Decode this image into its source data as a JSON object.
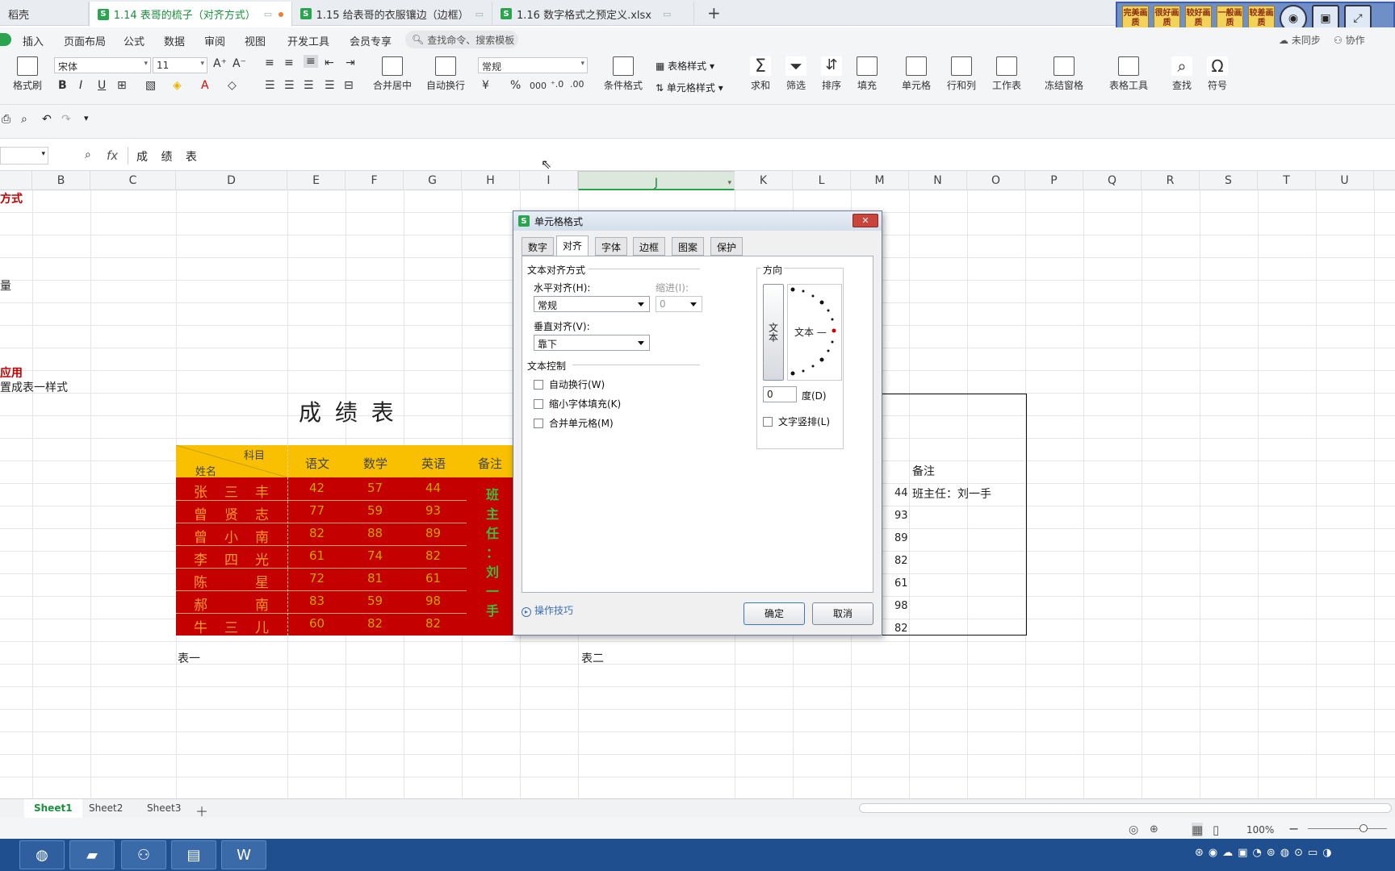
{
  "tabs": [
    {
      "label": "稻壳"
    },
    {
      "label": "1.14 表哥的梳子（对齐方式）"
    },
    {
      "label": "1.15 给表哥的衣服镶边（边框）"
    },
    {
      "label": "1.16 数字格式之预定义.xlsx"
    }
  ],
  "new_tab": "+",
  "quality_buttons": [
    "完美画质",
    "很好画质",
    "较好画质",
    "一般画质",
    "较差画质"
  ],
  "sync": {
    "not_synced": "未同步",
    "collab": "协作"
  },
  "menu": [
    "插入",
    "页面布局",
    "公式",
    "数据",
    "审阅",
    "视图",
    "开发工具",
    "会员专享"
  ],
  "search_cmd": "查找命令、搜索模板",
  "ribbon": {
    "format_brush": "格式刷",
    "font_name": "宋体",
    "font_size": "11",
    "merge_center": "合并居中",
    "auto_wrap": "自动换行",
    "num_format": "常规",
    "cond_format": "条件格式",
    "table_style": "表格样式",
    "cell_style": "单元格样式",
    "sum": "求和",
    "filter": "筛选",
    "sort": "排序",
    "fill": "填充",
    "cell": "单元格",
    "row_col": "行和列",
    "worksheet": "工作表",
    "freeze": "冻结窗格",
    "table_tools": "表格工具",
    "find": "查找",
    "symbol": "符号",
    "yen": "¥",
    "percent": "%",
    "thousands": "000"
  },
  "formula": {
    "fx": "fx",
    "value": "成 绩 表"
  },
  "columns": [
    "B",
    "C",
    "D",
    "E",
    "F",
    "G",
    "H",
    "I",
    "J",
    "K",
    "L",
    "M",
    "N",
    "O",
    "P",
    "Q",
    "R",
    "S",
    "T",
    "U"
  ],
  "left_text": {
    "a": "方式",
    "b": "量",
    "c": "应用",
    "d": "置成表一样式"
  },
  "t1": {
    "title": "成 绩 表",
    "subject": "科目",
    "name": "姓名",
    "h": [
      "语文",
      "数学",
      "英语",
      "备注"
    ],
    "rows": [
      {
        "n": "张　三　丰",
        "v": [
          "42",
          "57",
          "44"
        ]
      },
      {
        "n": "曾　贤　志",
        "v": [
          "77",
          "59",
          "93"
        ]
      },
      {
        "n": "曾　小　南",
        "v": [
          "82",
          "88",
          "89"
        ]
      },
      {
        "n": "李　四　光",
        "v": [
          "61",
          "74",
          "82"
        ]
      },
      {
        "n": "陈　　　星",
        "v": [
          "72",
          "81",
          "61"
        ]
      },
      {
        "n": "郝　　　南",
        "v": [
          "83",
          "59",
          "98"
        ]
      },
      {
        "n": "牛　三　儿",
        "v": [
          "60",
          "82",
          "82"
        ]
      }
    ],
    "note": [
      "班",
      "主",
      "任",
      "：",
      "刘",
      "一",
      "手"
    ],
    "caption": "表一"
  },
  "t2": {
    "caption": "表二",
    "note_header": "备注",
    "note": "班主任：刘一手",
    "nums": [
      "44",
      "93",
      "89",
      "82",
      "61",
      "98",
      "82"
    ]
  },
  "dialog": {
    "title": "单元格格式",
    "tabs": [
      "数字",
      "对齐",
      "字体",
      "边框",
      "图案",
      "保护"
    ],
    "text_align": "文本对齐方式",
    "h_align": "水平对齐(H):",
    "h_val": "常规",
    "indent": "缩进(I):",
    "indent_val": "0",
    "v_align": "垂直对齐(V):",
    "v_val": "靠下",
    "text_ctrl": "文本控制",
    "cb": [
      "自动换行(W)",
      "缩小字体填充(K)",
      "合并单元格(M)"
    ],
    "direction": "方向",
    "vert_text": "文本",
    "dial_text": "文本 —",
    "deg_val": "0",
    "deg": "度(D)",
    "vertical_layout": "文字竖排(L)",
    "tips": "操作技巧",
    "ok": "确定",
    "cancel": "取消"
  },
  "sheets": [
    "Sheet1",
    "Sheet2",
    "Sheet3"
  ],
  "zoom": "100%"
}
